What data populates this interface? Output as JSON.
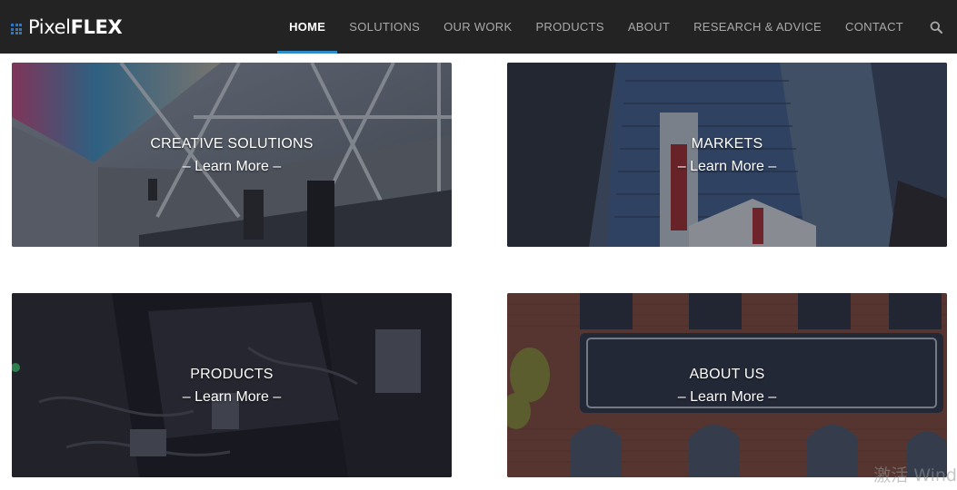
{
  "brand": {
    "name_light": "Pixel",
    "name_bold": "FLEX",
    "accent": "#2d8bc9"
  },
  "nav": {
    "items": [
      {
        "label": "HOME",
        "active": true
      },
      {
        "label": "SOLUTIONS",
        "active": false
      },
      {
        "label": "OUR WORK",
        "active": false
      },
      {
        "label": "PRODUCTS",
        "active": false
      },
      {
        "label": "ABOUT",
        "active": false
      },
      {
        "label": "RESEARCH & ADVICE",
        "active": false
      },
      {
        "label": "CONTACT",
        "active": false
      }
    ],
    "search_icon": "search-icon"
  },
  "tiles": [
    {
      "title": "CREATIVE SOLUTIONS",
      "more": "– Learn More –"
    },
    {
      "title": "MARKETS",
      "more": "– Learn More –"
    },
    {
      "title": "PRODUCTS",
      "more": "– Learn More –"
    },
    {
      "title": "ABOUT US",
      "more": "– Learn More –"
    }
  ],
  "watermark": "激活 Wind"
}
